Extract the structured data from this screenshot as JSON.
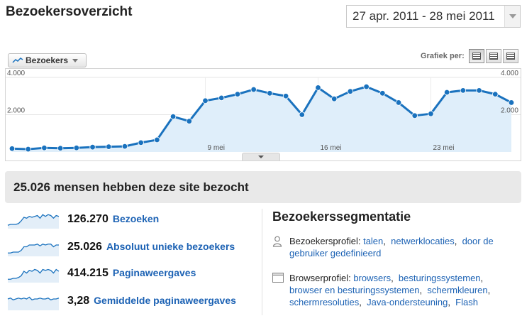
{
  "header": {
    "title": "Bezoekersoverzicht",
    "date_range": "27 apr. 2011 - 28 mei 2011"
  },
  "chart_controls": {
    "metric_label": "Bezoekers",
    "graph_by_label": "Grafiek per:",
    "graph_buttons": [
      "day-view-icon",
      "week-view-icon",
      "month-view-icon"
    ]
  },
  "chart_data": {
    "type": "area",
    "title": "",
    "x_tick_labels": [
      "9 mei",
      "16 mei",
      "23 mei"
    ],
    "y_tick_labels_left": [
      "4.000",
      "2.000"
    ],
    "y_tick_labels_right": [
      "4.000",
      "2.000"
    ],
    "ylim": [
      0,
      4000
    ],
    "grid": true,
    "color": "#1a72be",
    "fill": "#dfeefa",
    "series": [
      {
        "dates": [
          "2011-04-27",
          "2011-04-28",
          "2011-04-29",
          "2011-04-30",
          "2011-05-01",
          "2011-05-02",
          "2011-05-03",
          "2011-05-04",
          "2011-05-05",
          "2011-05-06",
          "2011-05-07",
          "2011-05-08",
          "2011-05-09",
          "2011-05-10",
          "2011-05-11",
          "2011-05-12",
          "2011-05-13",
          "2011-05-14",
          "2011-05-15",
          "2011-05-16",
          "2011-05-17",
          "2011-05-18",
          "2011-05-19",
          "2011-05-20",
          "2011-05-21",
          "2011-05-22",
          "2011-05-23",
          "2011-05-24",
          "2011-05-25",
          "2011-05-26",
          "2011-05-27",
          "2011-05-28"
        ],
        "values": [
          180,
          150,
          220,
          200,
          220,
          260,
          280,
          300,
          500,
          650,
          1900,
          1650,
          2750,
          2900,
          3100,
          3350,
          3150,
          3000,
          2000,
          3450,
          2850,
          3250,
          3500,
          3150,
          2650,
          1950,
          2050,
          3200,
          3300,
          3300,
          3100,
          2650
        ]
      }
    ]
  },
  "summary": {
    "text": "25.026 mensen hebben deze site bezocht"
  },
  "stats": [
    {
      "value": "126.270",
      "label": "Bezoeken",
      "spark": [
        3,
        4,
        4,
        4,
        5,
        8,
        12,
        11,
        13,
        12,
        13,
        14,
        11,
        15,
        13,
        15,
        14,
        11,
        14,
        13
      ]
    },
    {
      "value": "25.026",
      "label": "Absoluut unieke bezoekers",
      "spark": [
        3,
        3,
        4,
        4,
        4,
        6,
        10,
        10,
        12,
        12,
        12,
        13,
        11,
        13,
        12,
        13,
        13,
        10,
        12,
        12
      ]
    },
    {
      "value": "414.215",
      "label": "Paginaweergaves",
      "spark": [
        3,
        3,
        4,
        4,
        5,
        7,
        12,
        10,
        13,
        12,
        14,
        13,
        10,
        14,
        13,
        14,
        13,
        10,
        14,
        12
      ]
    },
    {
      "value": "3,28",
      "label": "Gemiddelde paginaweergaves",
      "spark": [
        12,
        13,
        11,
        12,
        13,
        12,
        13,
        12,
        14,
        11,
        12,
        12,
        13,
        12,
        12,
        13,
        11,
        12,
        12,
        13
      ]
    }
  ],
  "segmentation": {
    "title": "Bezoekerssegmentatie",
    "visitor_profile": {
      "label": "Bezoekersprofiel:",
      "links": [
        "talen",
        "netwerklocaties",
        "door de gebruiker gedefinieerd"
      ]
    },
    "browser_profile": {
      "label": "Browserprofiel:",
      "links": [
        "browsers",
        "besturingssystemen",
        "browser en besturingssystemen",
        "schermkleuren",
        "schermresoluties",
        "Java-ondersteuning",
        "Flash"
      ]
    }
  }
}
